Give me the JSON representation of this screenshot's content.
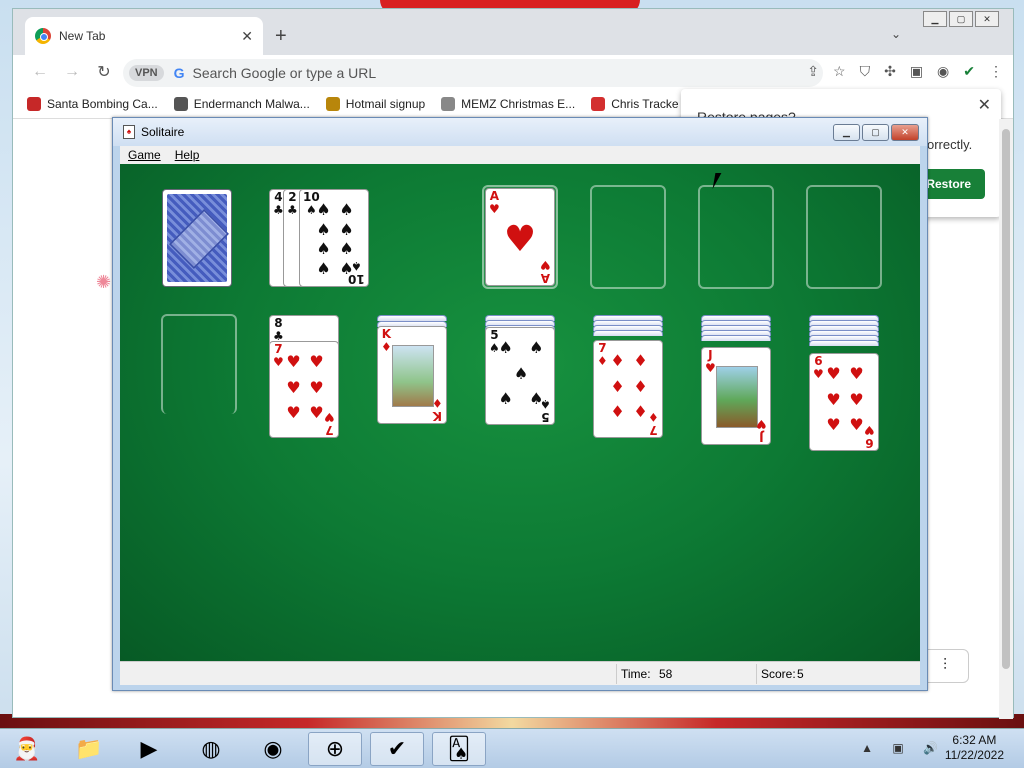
{
  "browser": {
    "tab_title": "New Tab",
    "new_tab_symbol": "+",
    "omnibox_placeholder": "Search Google or type a URL",
    "vpn_label": "VPN",
    "bookmarks": [
      {
        "label": "Santa Bombing Ca...",
        "icon": "santa-icon"
      },
      {
        "label": "Endermanch Malwa...",
        "icon": "raccoon-icon"
      },
      {
        "label": "Hotmail signup",
        "icon": "person-icon"
      },
      {
        "label": "MEMZ Christmas E...",
        "icon": "memz-icon"
      },
      {
        "label": "Chris Tracke",
        "icon": "chris-icon"
      }
    ],
    "restore_popup": {
      "title": "Restore pages?",
      "body": "orrectly.",
      "button": "Restore"
    }
  },
  "solitaire": {
    "title": "Solitaire",
    "menu": [
      "Game",
      "Help"
    ],
    "status": {
      "time_label": "Time:",
      "time_value": "58",
      "score_label": "Score:",
      "score_value": "5"
    },
    "waste": [
      {
        "rank": "4",
        "suit": "♣"
      },
      {
        "rank": "2",
        "suit": "♣"
      },
      {
        "rank": "10",
        "suit": "♠"
      }
    ],
    "foundations": [
      {
        "rank": "A",
        "suit": "♥"
      },
      null,
      null,
      null
    ],
    "tableau": [
      {
        "hidden": 0,
        "top": null
      },
      {
        "hidden": 0,
        "cards": [
          {
            "rank": "8",
            "suit": "♣"
          },
          {
            "rank": "7",
            "suit": "♥"
          }
        ]
      },
      {
        "hidden": 2,
        "cards": [
          {
            "rank": "K",
            "suit": "♦"
          }
        ]
      },
      {
        "hidden": 3,
        "cards": [
          {
            "rank": "5",
            "suit": "♠"
          }
        ]
      },
      {
        "hidden": 4,
        "cards": [
          {
            "rank": "7",
            "suit": "♦"
          }
        ]
      },
      {
        "hidden": 5,
        "cards": [
          {
            "rank": "J",
            "suit": "♥"
          }
        ]
      },
      {
        "hidden": 6,
        "cards": [
          {
            "rank": "6",
            "suit": "♥"
          }
        ]
      }
    ]
  },
  "taskbar": {
    "apps": [
      "santa-app-icon",
      "file-explorer-icon",
      "media-player-icon",
      "chrome-icon",
      "firefox-icon",
      "vpn-app-icon",
      "checkmark-app-icon",
      "solitaire-app-icon"
    ],
    "clock_time": "6:32 AM",
    "clock_date": "11/22/2022"
  }
}
